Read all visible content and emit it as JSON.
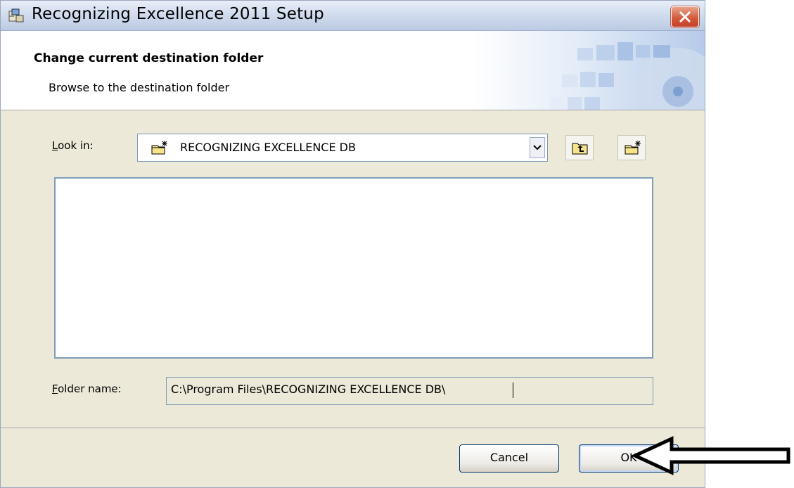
{
  "window": {
    "title": "Recognizing Excellence 2011 Setup"
  },
  "header": {
    "title": "Change current destination folder",
    "subtitle": "Browse to the destination folder"
  },
  "look_in": {
    "label_accel": "L",
    "label_rest": "ook in:",
    "selected": "RECOGNIZING EXCELLENCE DB"
  },
  "folder_name": {
    "label_accel": "F",
    "label_rest": "older name:",
    "value": "C:\\Program Files\\RECOGNIZING EXCELLENCE DB\\"
  },
  "buttons": {
    "cancel": "Cancel",
    "ok": "OK"
  },
  "icons": {
    "app": "setup-icon",
    "close": "close-icon",
    "up_one_level": "folder-up-icon",
    "new_folder": "new-folder-icon",
    "dropdown": "chevron-down-icon",
    "annotation": "arrow-left-icon"
  },
  "colors": {
    "dialog_bg": "#ece9d8",
    "close_red": "#d2563a",
    "input_border": "#7f9db9"
  }
}
